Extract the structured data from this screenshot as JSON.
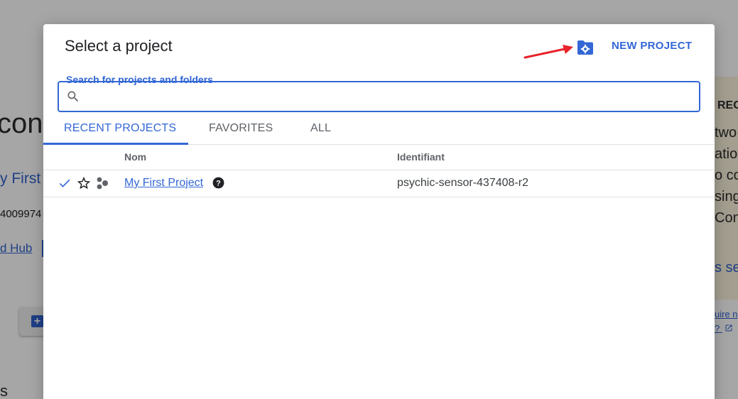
{
  "background": {
    "title_fragment": "con",
    "project_link_fragment": "y First",
    "number_fragment": "4009974",
    "hub_link_fragment": "d Hub",
    "plus_symbol": "+",
    "bottom_fragment": "s",
    "panel": {
      "heading_fragment": "REC",
      "line1": "two",
      "line2": "ation",
      "line3": "o co",
      "line4": "sing",
      "line5": "Con",
      "link": "s se"
    },
    "learn_more_fragment": "uire n",
    "learn_more_fragment2": "?"
  },
  "dialog": {
    "title": "Select a project",
    "new_project_label": "NEW PROJECT",
    "new_folder_icon": "folder-settings-icon",
    "search": {
      "label": "Search for projects and folders",
      "placeholder": "",
      "value": ""
    },
    "tabs": [
      {
        "label": "RECENT PROJECTS",
        "active": true
      },
      {
        "label": "FAVORITES",
        "active": false
      },
      {
        "label": "ALL",
        "active": false
      }
    ],
    "columns": {
      "name": "Nom",
      "id": "Identifiant"
    },
    "rows": [
      {
        "selected": true,
        "favorite": false,
        "name": "My First Project",
        "id": "psychic-sensor-437408-r2"
      }
    ],
    "colors": {
      "accent": "#3367d6",
      "annotation_arrow": "#e8232a"
    }
  }
}
